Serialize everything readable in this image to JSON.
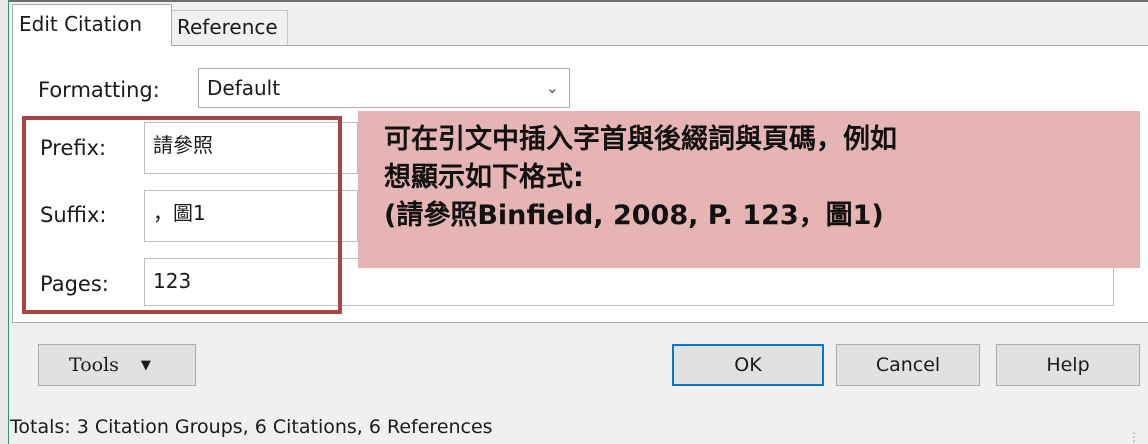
{
  "tabs": [
    {
      "label": "Edit Citation",
      "active": true
    },
    {
      "label": "Reference",
      "active": false
    }
  ],
  "formatting": {
    "label": "Formatting:",
    "value": "Default"
  },
  "fields": {
    "prefix": {
      "label": "Prefix:",
      "value": "請參照"
    },
    "suffix": {
      "label": "Suffix:",
      "value": "，圖1"
    },
    "pages": {
      "label": "Pages:",
      "value": "123"
    }
  },
  "callout": {
    "line1": "可在引文中插入字首與後綴詞與頁碼，例如",
    "line2": "想顯示如下格式:",
    "line3": "(請參照Binfield, 2008, P. 123，圖1)",
    "bg_color": "#e6b4b4",
    "highlight_border_color": "#a94445"
  },
  "buttons": {
    "tools": "Tools",
    "ok": "OK",
    "cancel": "Cancel",
    "help": "Help"
  },
  "status": "Totals: 3 Citation Groups, 6 Citations, 6 References",
  "icons": {
    "dropdown": "chevron-down-icon",
    "tools_menu": "caret-down-icon"
  },
  "accent_color": "#0078d7"
}
